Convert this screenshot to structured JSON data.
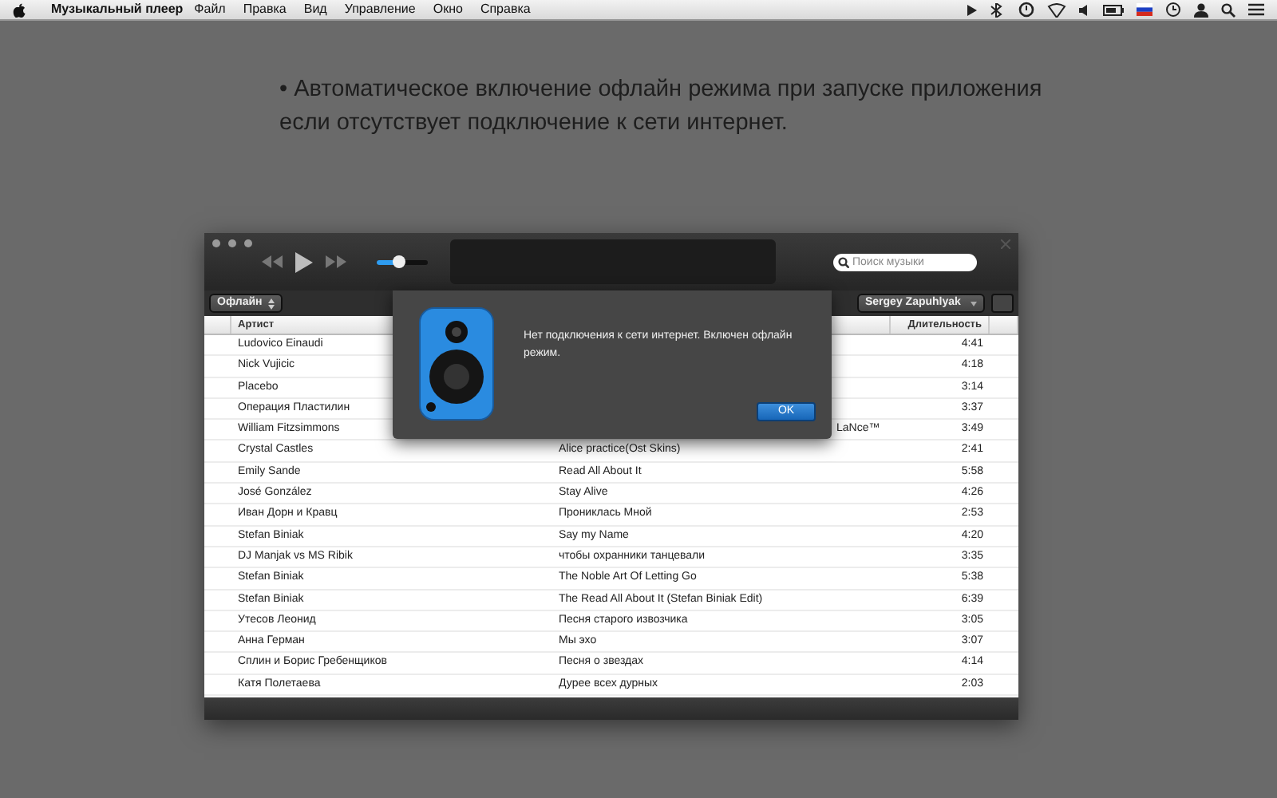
{
  "menubar": {
    "app": "Музыкальный плеер",
    "menus": [
      "Файл",
      "Правка",
      "Вид",
      "Управление",
      "Окно",
      "Справка"
    ]
  },
  "note": "• Автоматическое включение офлайн режима при запуске приложения если отсутствует подключение к сети интернет.",
  "player": {
    "volume": {
      "level": 0.45
    },
    "search": {
      "placeholder": "Поиск музыки"
    },
    "mode": "Офлайн",
    "user": "Sergey Zapuhlyak",
    "table": {
      "columns": [
        "Артист",
        "Длительность"
      ],
      "rows": [
        {
          "artist": "Ludovico Einaudi",
          "duration": "4:41"
        },
        {
          "artist": "Nick Vujicic",
          "duration": "4:18"
        },
        {
          "artist": "Placebo",
          "duration": "3:14"
        },
        {
          "artist": "Операция Пластилин",
          "duration": "3:37"
        },
        {
          "artist": "William Fitzsimmons",
          "title": "LaNce™",
          "title_partly_hidden": true,
          "duration": "3:49"
        },
        {
          "artist": "Crystal Castles",
          "title": "Alice practice(Ost Skins)",
          "duration": "2:41"
        },
        {
          "artist": "Emily Sande",
          "title": "Read All About It",
          "duration": "5:58"
        },
        {
          "artist": "José González",
          "title": "Stay Alive",
          "duration": "4:26"
        },
        {
          "artist": "Иван Дорн и Кравц",
          "title": "Прониклась Мной",
          "duration": "2:53"
        },
        {
          "artist": "Stefan Biniak",
          "title": "Say my Name",
          "duration": "4:20"
        },
        {
          "artist": "DJ Manjak vs MS Ribik",
          "title": "чтобы охранники танцевали",
          "duration": "3:35"
        },
        {
          "artist": "Stefan Biniak",
          "title": "The Noble Art Of Letting Go",
          "duration": "5:38"
        },
        {
          "artist": "Stefan Biniak",
          "title": "The Read All About It (Stefan Biniak Edit)",
          "duration": "6:39"
        },
        {
          "artist": "Утесов Леонид",
          "title": "Песня старого извозчика",
          "duration": "3:05"
        },
        {
          "artist": "Анна Герман",
          "title": "Мы эхо",
          "duration": "3:07"
        },
        {
          "artist": "Сплин и Борис Гребенщиков",
          "title": "Песня о звездах",
          "duration": "4:14"
        },
        {
          "artist": "Катя Полетаева",
          "title": "Дурее всех дурных",
          "duration": "2:03"
        }
      ]
    }
  },
  "dialog": {
    "message": "Нет подключения к сети интернет. Включен офлайн режим.",
    "button": "OK"
  }
}
